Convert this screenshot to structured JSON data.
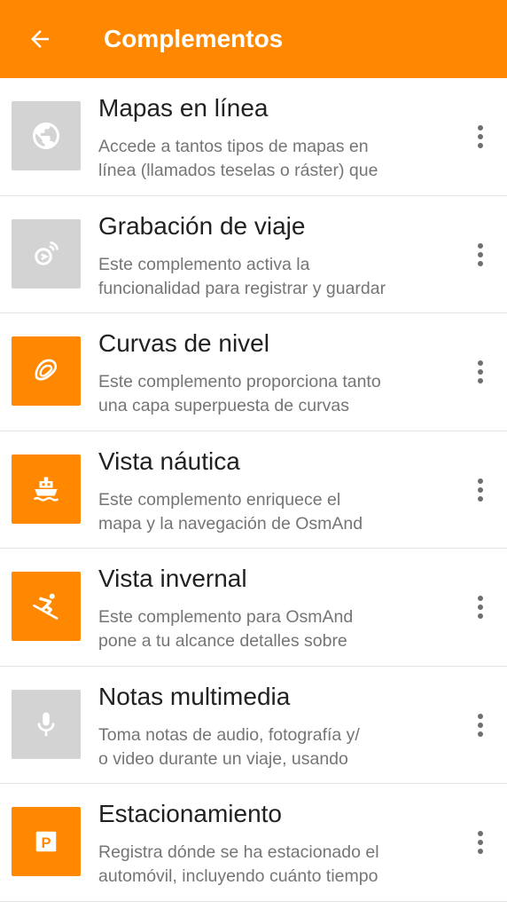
{
  "header": {
    "title": "Complementos",
    "back_icon": "arrow-left-icon",
    "background": "#ff8800"
  },
  "colors": {
    "accent": "#ff8800",
    "disabled_icon_bg": "#d3d3d3"
  },
  "plugins": [
    {
      "title": "Mapas en línea",
      "desc_line1": "Accede a tantos tipos de mapas en",
      "desc_line2": "línea (llamados teselas o ráster) que",
      "icon": "globe-icon",
      "enabled": false
    },
    {
      "title": "Grabación de viaje",
      "desc_line1": "Este complemento activa la",
      "desc_line2": "funcionalidad para registrar y guardar",
      "icon": "trip-recording-icon",
      "enabled": false
    },
    {
      "title": "Curvas de nivel",
      "desc_line1": "Este complemento proporciona tanto",
      "desc_line2": "una capa superpuesta de curvas",
      "icon": "contour-lines-icon",
      "enabled": true
    },
    {
      "title": "Vista náutica",
      "desc_line1": "Este complemento enriquece el",
      "desc_line2": "mapa y la navegación de OsmAnd",
      "icon": "ship-icon",
      "enabled": true
    },
    {
      "title": "Vista invernal",
      "desc_line1": "Este complemento para OsmAnd",
      "desc_line2": "pone a tu alcance detalles sobre",
      "icon": "skier-icon",
      "enabled": true
    },
    {
      "title": "Notas multimedia",
      "desc_line1": "Toma notas de audio, fotografía y/",
      "desc_line2": "o video durante un viaje, usando",
      "icon": "microphone-icon",
      "enabled": false
    },
    {
      "title": "Estacionamiento",
      "desc_line1": "Registra dónde se ha estacionado el",
      "desc_line2": "automóvil, incluyendo cuánto tiempo",
      "icon": "parking-icon",
      "enabled": true
    }
  ]
}
